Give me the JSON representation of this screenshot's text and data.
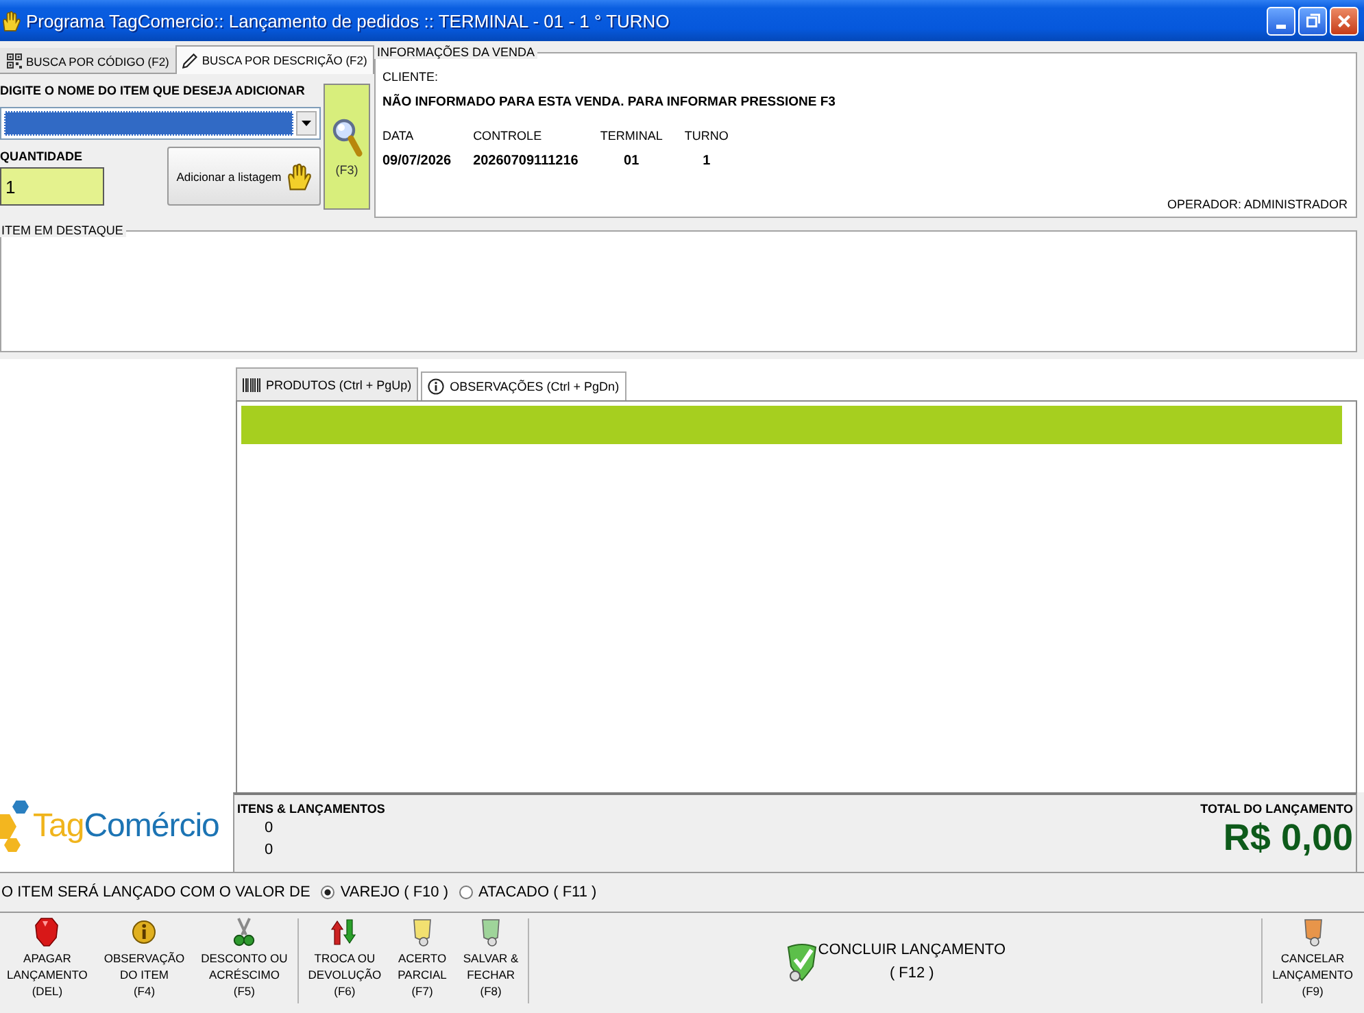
{
  "window": {
    "title": "Programa TagComercio:: Lançamento de pedidos :: TERMINAL - 01 - 1 ° TURNO"
  },
  "search_panel": {
    "tabs": [
      {
        "label": "BUSCA POR CÓDIGO (F2)",
        "selected": false
      },
      {
        "label": "BUSCA POR DESCRIÇÃO (F2)",
        "selected": true
      }
    ],
    "item_field": {
      "label": "DIGITE O NOME DO ITEM QUE DESEJA ADICIONAR",
      "focused": true
    },
    "quantity": {
      "label": "QUANTIDADE",
      "value": "1"
    },
    "add_button": {
      "label": "Adicionar a listagem"
    },
    "search_button": {
      "label": "(F3)"
    }
  },
  "sale_info": {
    "title": "INFORMAÇÕES DA VENDA",
    "client_label": "CLIENTE:",
    "client_value": "NÃO INFORMADO PARA ESTA VENDA. PARA INFORMAR PRESSIONE F3",
    "fields": [
      {
        "label": "DATA",
        "value": "09/07/2026"
      },
      {
        "label": "CONTROLE",
        "value": "20260709111216"
      },
      {
        "label": "TERMINAL",
        "value": "01"
      },
      {
        "label": "TURNO",
        "value": "1"
      }
    ],
    "operator": "OPERADOR: ADMINISTRADOR"
  },
  "featured_item": {
    "title": "ITEM EM DESTAQUE"
  },
  "logo": {
    "parts": [
      "Tag",
      "Comércio"
    ]
  },
  "content_tabs": [
    {
      "label": "PRODUTOS (Ctrl + PgUp)",
      "selected": true
    },
    {
      "label": "OBSERVAÇÕES (Ctrl + PgDn)",
      "selected": false
    }
  ],
  "totals": {
    "items_label": "ITENS & LANÇAMENTOS",
    "counts": [
      "0",
      "0"
    ],
    "total_label": "TOTAL DO LANÇAMENTO",
    "total_value": "R$ 0,00"
  },
  "price_mode": {
    "label": "O ITEM SERÁ LANÇADO COM O VALOR DE",
    "options": [
      {
        "label": "VAREJO ( F10 )",
        "selected": true
      },
      {
        "label": "ATACADO ( F11 )",
        "selected": false
      }
    ]
  },
  "toolbar": {
    "groups": [
      {
        "kind": "stacked",
        "buttons": [
          {
            "lines": [
              "APAGAR",
              "LANÇAMENTO",
              "(DEL)"
            ]
          },
          {
            "lines": [
              "OBSERVAÇÃO",
              "DO ITEM",
              "(F4)"
            ]
          },
          {
            "lines": [
              "DESCONTO OU",
              "ACRÉSCIMO",
              "(F5)"
            ]
          }
        ]
      },
      {
        "kind": "stacked",
        "buttons": [
          {
            "lines": [
              "TROCA OU",
              "DEVOLUÇÃO",
              "(F6)"
            ]
          },
          {
            "lines": [
              "ACERTO",
              "PARCIAL",
              "(F7)"
            ]
          },
          {
            "lines": [
              "SALVAR &",
              "FECHAR",
              "(F8)"
            ]
          }
        ]
      },
      {
        "kind": "inline",
        "buttons": [
          {
            "lines": [
              "CONCLUIR LANÇAMENTO",
              "( F12 )"
            ]
          }
        ]
      },
      {
        "kind": "stacked",
        "buttons": [
          {
            "lines": [
              "CANCELAR",
              "LANÇAMENTO",
              "(F9)"
            ]
          }
        ]
      }
    ]
  }
}
